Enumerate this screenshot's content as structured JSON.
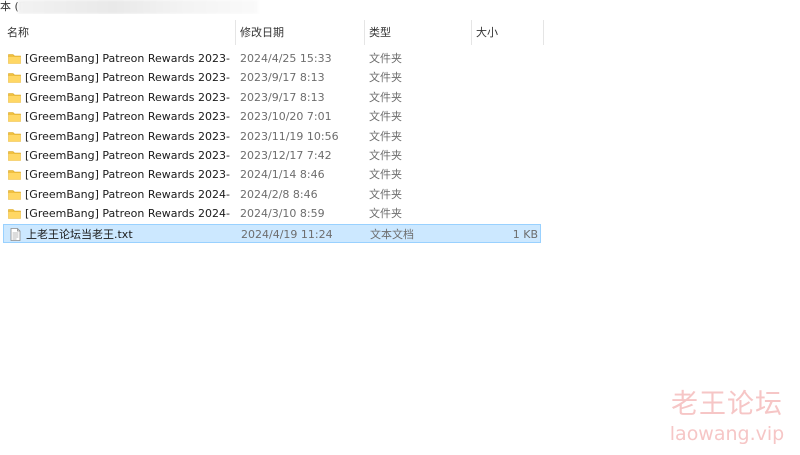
{
  "address": {
    "text": "本 (F:"
  },
  "columns": {
    "name": "名称",
    "date": "修改日期",
    "type": "类型",
    "size": "大小"
  },
  "files": [
    {
      "name": "[GreemBang] Patreon Rewards 2023-...",
      "date": "2024/4/25 15:33",
      "type": "文件夹",
      "size": "",
      "icon": "folder-icon"
    },
    {
      "name": "[GreemBang] Patreon Rewards 2023-...",
      "date": "2023/9/17 8:13",
      "type": "文件夹",
      "size": "",
      "icon": "folder-icon"
    },
    {
      "name": "[GreemBang] Patreon Rewards 2023-...",
      "date": "2023/9/17 8:13",
      "type": "文件夹",
      "size": "",
      "icon": "folder-icon"
    },
    {
      "name": "[GreemBang] Patreon Rewards 2023-...",
      "date": "2023/10/20 7:01",
      "type": "文件夹",
      "size": "",
      "icon": "folder-icon"
    },
    {
      "name": "[GreemBang] Patreon Rewards 2023-...",
      "date": "2023/11/19 10:56",
      "type": "文件夹",
      "size": "",
      "icon": "folder-icon"
    },
    {
      "name": "[GreemBang] Patreon Rewards 2023-...",
      "date": "2023/12/17 7:42",
      "type": "文件夹",
      "size": "",
      "icon": "folder-icon"
    },
    {
      "name": "[GreemBang] Patreon Rewards 2023-...",
      "date": "2024/1/14 8:46",
      "type": "文件夹",
      "size": "",
      "icon": "folder-icon"
    },
    {
      "name": "[GreemBang] Patreon Rewards 2024-...",
      "date": "2024/2/8 8:46",
      "type": "文件夹",
      "size": "",
      "icon": "folder-icon"
    },
    {
      "name": "[GreemBang] Patreon Rewards 2024-...",
      "date": "2024/3/10 8:59",
      "type": "文件夹",
      "size": "",
      "icon": "folder-icon"
    },
    {
      "name": "上老王论坛当老王.txt",
      "date": "2024/4/19 11:24",
      "type": "文本文档",
      "size": "1 KB",
      "icon": "text-file-icon",
      "selected": true
    }
  ],
  "watermark": {
    "chinese": "老王论坛",
    "url": "laowang.vip"
  },
  "colors": {
    "folder": "#f0c040",
    "selection_bg": "#cce8ff",
    "selection_border": "#99d1ff",
    "watermark": "#f6c6c6"
  }
}
